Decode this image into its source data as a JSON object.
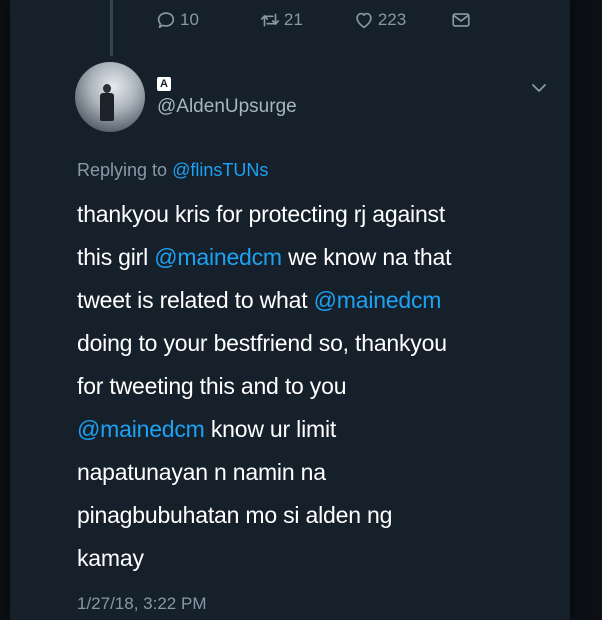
{
  "actions": {
    "reply_count": "10",
    "retweet_count": "21",
    "like_count": "223"
  },
  "tweet": {
    "badge": "A",
    "handle": "@AldenUpsurge",
    "replying_prefix": "Replying to",
    "replying_to": "@flinsTUNs",
    "lines": [
      [
        {
          "t": "thankyou kris for protecting rj against"
        }
      ],
      [
        {
          "t": "this girl "
        },
        {
          "m": "@mainedcm"
        },
        {
          "t": " we know na that"
        }
      ],
      [
        {
          "t": "tweet is related to what "
        },
        {
          "m": "@mainedcm"
        }
      ],
      [
        {
          "t": "doing to your bestfriend so, thankyou"
        }
      ],
      [
        {
          "t": "for tweeting this and to you"
        }
      ],
      [
        {
          "m": "@mainedcm"
        },
        {
          "t": " know ur limit"
        }
      ],
      [
        {
          "t": "napatunayan n namin na"
        }
      ],
      [
        {
          "t": "pinagbubuhatan mo si alden ng"
        }
      ],
      [
        {
          "t": "kamay"
        }
      ]
    ],
    "timestamp": "1/27/18, 3:22 PM"
  },
  "colors": {
    "background": "#15202b",
    "text": "#ffffff",
    "secondary": "#8899a6",
    "accent": "#1da1f2"
  },
  "icons": {
    "reply": "comment-icon",
    "retweet": "retweet-icon",
    "like": "heart-icon",
    "dm": "mail-icon",
    "more": "chevron-down-icon"
  }
}
